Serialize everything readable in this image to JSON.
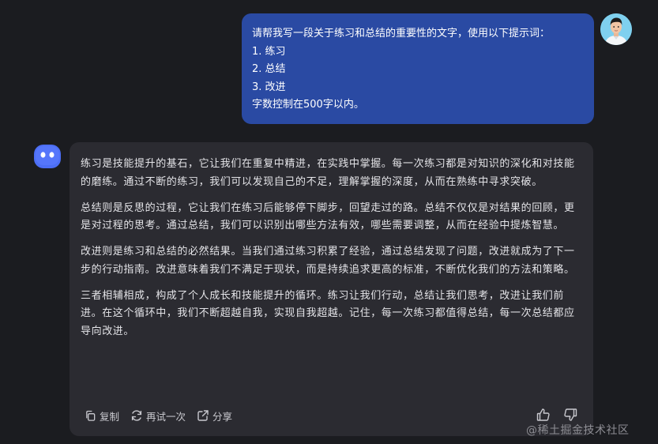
{
  "user_message": {
    "lines": [
      "请帮我写一段关于练习和总结的重要性的文字，使用以下提示词：",
      "1. 练习",
      "2. 总结",
      "3. 改进",
      "字数控制在500字以内。"
    ]
  },
  "bot_response": {
    "paragraphs": [
      "练习是技能提升的基石，它让我们在重复中精进，在实践中掌握。每一次练习都是对知识的深化和对技能的磨练。通过不断的练习，我们可以发现自己的不足，理解掌握的深度，从而在熟练中寻求突破。",
      "总结则是反思的过程，它让我们在练习后能够停下脚步，回望走过的路。总结不仅仅是对结果的回顾，更是对过程的思考。通过总结，我们可以识别出哪些方法有效，哪些需要调整，从而在经验中提炼智慧。",
      "改进则是练习和总结的必然结果。当我们通过练习积累了经验，通过总结发现了问题，改进就成为了下一步的行动指南。改进意味着我们不满足于现状，而是持续追求更高的标准，不断优化我们的方法和策略。",
      "三者相辅相成，构成了个人成长和技能提升的循环。练习让我们行动，总结让我们思考，改进让我们前进。在这个循环中，我们不断超越自我，实现自我超越。记住，每一次练习都值得总结，每一次总结都应导向改进。"
    ]
  },
  "actions": {
    "copy_label": "复制",
    "regenerate_label": "再试一次",
    "share_label": "分享"
  },
  "watermark": "@稀土掘金技术社区",
  "colors": {
    "background": "#1b1c20",
    "user_bubble": "#2a4aa3",
    "bot_card": "#2b2b31",
    "bot_avatar": "#4c6ef5"
  },
  "icons": [
    "copy-icon",
    "refresh-icon",
    "share-icon",
    "thumbs-up-icon",
    "thumbs-down-icon"
  ]
}
